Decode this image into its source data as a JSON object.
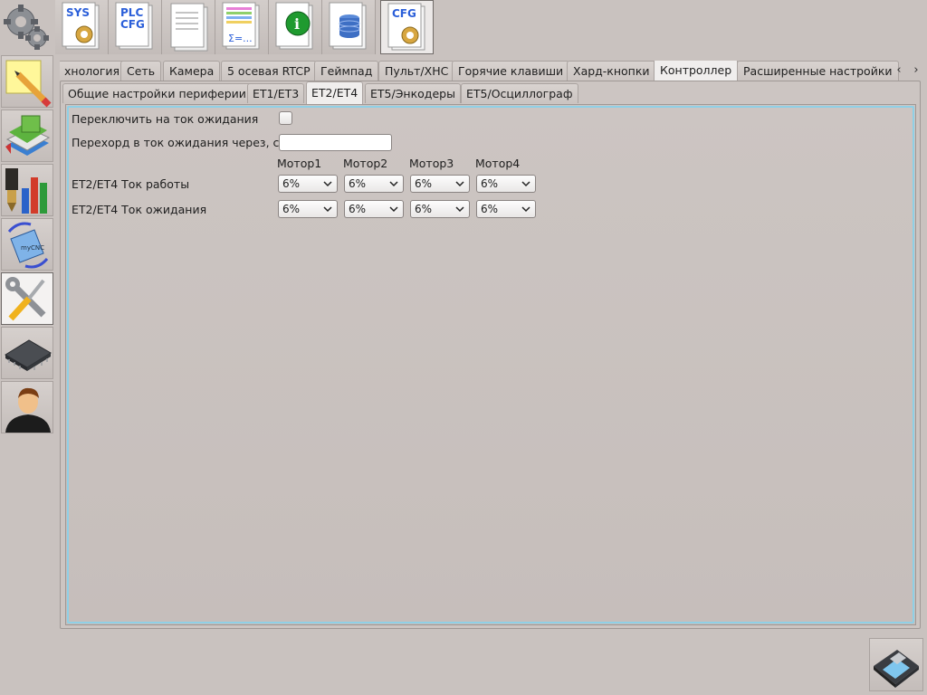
{
  "toolbar": {
    "sys_label": "SYS",
    "plc_label_1": "PLC",
    "plc_label_2": "CFG",
    "sum_label": "Σ=...",
    "info_label": "i",
    "cfg_label": "CFG",
    "icons": [
      "sys-gear-doc-icon",
      "plc-cfg-doc-icon",
      "blank-doc-icon",
      "table-sum-doc-icon",
      "info-doc-icon",
      "database-doc-icon",
      "cfg-gear-doc-icon"
    ]
  },
  "sidebar": {
    "icons": [
      "gears-icon",
      "note-pencil-icon",
      "books-icon",
      "tool-chart-icon",
      "rotate-mycnc-icon",
      "wrench-screwdriver-icon",
      "chip-icon",
      "user-icon"
    ],
    "mycnc_label": "myCNC"
  },
  "tabs": [
    {
      "label": "хнология"
    },
    {
      "label": "Сеть"
    },
    {
      "label": "Камера"
    },
    {
      "label": "5 осевая RTCP"
    },
    {
      "label": "Геймпад"
    },
    {
      "label": "Пульт/XHC"
    },
    {
      "label": "Горячие клавиши"
    },
    {
      "label": "Хард-кнопки"
    },
    {
      "label": "Контроллер"
    },
    {
      "label": "Расширенные настройки"
    }
  ],
  "tab_scroll": {
    "left": "‹",
    "right": "›"
  },
  "subtabs": [
    {
      "label": "Общие настройки периферии"
    },
    {
      "label": "ET1/ET3"
    },
    {
      "label": "ET2/ET4"
    },
    {
      "label": "ET5/Энкодеры"
    },
    {
      "label": "ET5/Осциллограф"
    }
  ],
  "form": {
    "standby_switch_label": "Переключить на ток ожидания",
    "standby_switch_checked": false,
    "standby_delay_label": "Перехорд в ток ожидания через, сек",
    "standby_delay_value": "",
    "motor_headers": [
      "Мотор1",
      "Мотор2",
      "Мотор3",
      "Мотор4"
    ],
    "run_current_label": "ET2/ET4 Ток работы",
    "run_current_values": [
      "6%",
      "6%",
      "6%",
      "6%"
    ],
    "idle_current_label": "ET2/ET4 Ток ожидания",
    "idle_current_values": [
      "6%",
      "6%",
      "6%",
      "6%"
    ]
  },
  "colors": {
    "background": "#c9c2bf",
    "focus_border": "#8fd0e6"
  }
}
